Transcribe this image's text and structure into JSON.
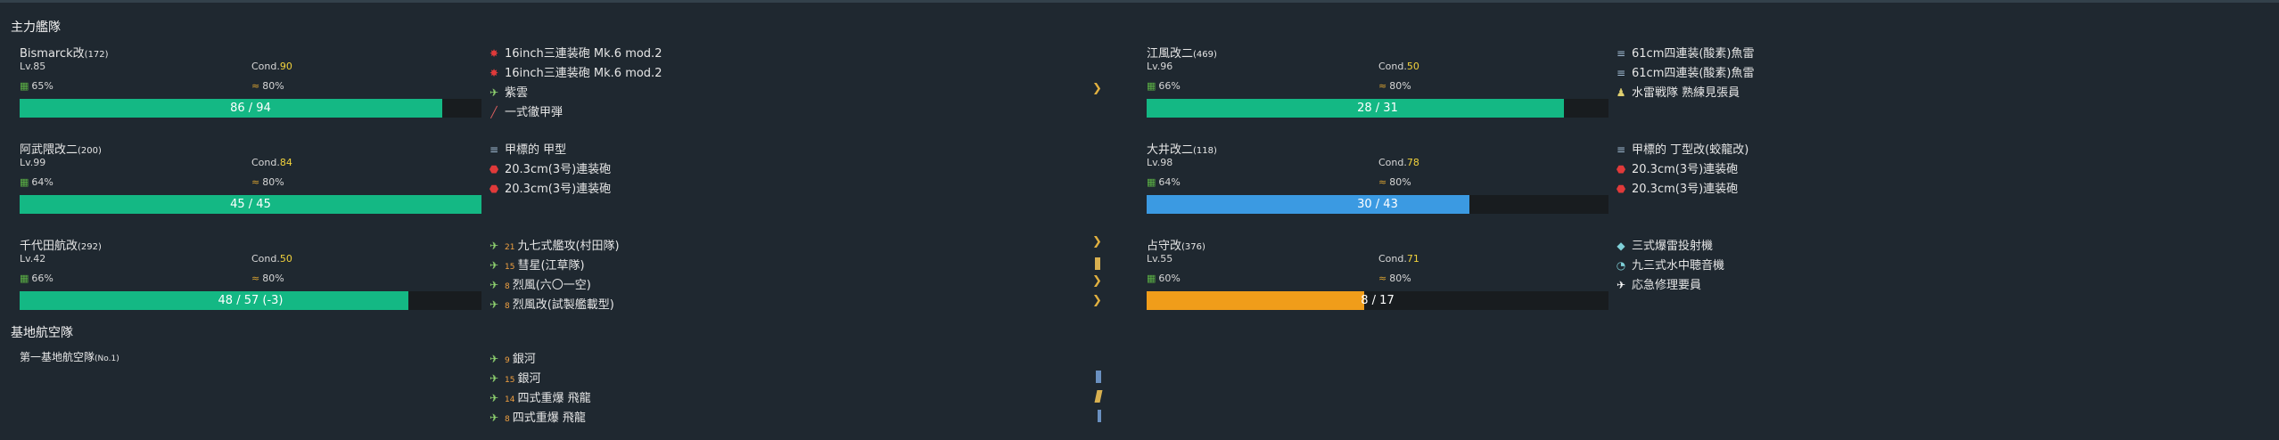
{
  "sections": {
    "main_fleet": "主力艦隊",
    "base_air": "基地航空隊"
  },
  "colors": {
    "green": "#14b884",
    "blue": "#3b9ae2",
    "orange": "#f09d1a",
    "cond_yellow": "#f2d23c"
  },
  "ships": [
    {
      "name": "Bismarck改",
      "id": "(172)",
      "lv": "Lv.85",
      "cond_label": "Cond.",
      "cond": "90",
      "fuel": "65%",
      "ammo": "80%",
      "hp_text": "86 / 94",
      "hp_ratio": 0.915,
      "hp_color": "green",
      "equip": [
        {
          "icon": "main-gun-icon",
          "name": "16inch三連装砲 Mk.6 mod.2"
        },
        {
          "icon": "main-gun-icon",
          "name": "16inch三連装砲 Mk.6 mod.2"
        },
        {
          "icon": "seaplane-icon",
          "name": "紫雲"
        },
        {
          "icon": "shell-icon",
          "name": "一式徹甲弾"
        }
      ],
      "badge": "ex-slot-icon"
    },
    {
      "name": "阿武隈改二",
      "id": "(200)",
      "lv": "Lv.99",
      "cond_label": "Cond.",
      "cond": "84",
      "fuel": "64%",
      "ammo": "80%",
      "hp_text": "45 / 45",
      "hp_ratio": 1.0,
      "hp_color": "green",
      "equip": [
        {
          "icon": "torpedo-icon",
          "name": "甲標的 甲型"
        },
        {
          "icon": "secondary-gun-icon",
          "name": "20.3cm(3号)連装砲"
        },
        {
          "icon": "secondary-gun-icon",
          "name": "20.3cm(3号)連装砲"
        }
      ]
    },
    {
      "name": "千代田航改",
      "id": "(292)",
      "lv": "Lv.42",
      "cond_label": "Cond.",
      "cond": "50",
      "fuel": "66%",
      "ammo": "80%",
      "hp_text": "48 / 57 (-3)",
      "hp_ratio": 0.842,
      "hp_color": "green",
      "equip": [
        {
          "icon": "torpedo-bomber-icon",
          "count": "21",
          "name": "九七式艦攻(村田隊)"
        },
        {
          "icon": "dive-bomber-icon",
          "count": "15",
          "name": "彗星(江草隊)"
        },
        {
          "icon": "fighter-icon",
          "count": "8",
          "name": "烈風(六〇一空)"
        },
        {
          "icon": "fighter-icon",
          "count": "8",
          "name": "烈風改(試製艦載型)"
        }
      ]
    },
    {
      "name": "江風改二",
      "id": "(469)",
      "lv": "Lv.96",
      "cond_label": "Cond.",
      "cond": "50",
      "fuel": "66%",
      "ammo": "80%",
      "hp_text": "28 / 31",
      "hp_ratio": 0.903,
      "hp_color": "green",
      "equip": [
        {
          "icon": "torpedo-icon",
          "name": "61cm四連装(酸素)魚雷"
        },
        {
          "icon": "torpedo-icon",
          "name": "61cm四連装(酸素)魚雷"
        },
        {
          "icon": "personnel-icon",
          "name": "水雷戦隊 熟練見張員"
        }
      ]
    },
    {
      "name": "大井改二",
      "id": "(118)",
      "lv": "Lv.98",
      "cond_label": "Cond.",
      "cond": "78",
      "fuel": "64%",
      "ammo": "80%",
      "hp_text": "30 / 43",
      "hp_ratio": 0.698,
      "hp_color": "blue",
      "equip": [
        {
          "icon": "torpedo-icon",
          "name": "甲標的 丁型改(蛟龍改)"
        },
        {
          "icon": "secondary-gun-icon",
          "name": "20.3cm(3号)連装砲"
        },
        {
          "icon": "secondary-gun-icon",
          "name": "20.3cm(3号)連装砲"
        }
      ]
    },
    {
      "name": "占守改",
      "id": "(376)",
      "lv": "Lv.55",
      "cond_label": "Cond.",
      "cond": "71",
      "fuel": "60%",
      "ammo": "80%",
      "hp_text": "8 / 17",
      "hp_ratio": 0.471,
      "hp_color": "orange",
      "equip": [
        {
          "icon": "depth-charge-icon",
          "name": "三式爆雷投射機"
        },
        {
          "icon": "sonar-icon",
          "name": "九三式水中聴音機"
        },
        {
          "icon": "repair-icon",
          "name": "応急修理要員"
        }
      ]
    }
  ],
  "base": {
    "name": "第一基地航空隊",
    "id": "(No.1)",
    "equip": [
      {
        "icon": "land-bomber-icon",
        "count": "9",
        "name": "銀河"
      },
      {
        "icon": "land-bomber-icon",
        "count": "15",
        "name": "銀河"
      },
      {
        "icon": "land-bomber-icon",
        "count": "14",
        "name": "四式重爆 飛龍"
      },
      {
        "icon": "land-bomber-icon",
        "count": "8",
        "name": "四式重爆 飛龍"
      }
    ]
  }
}
